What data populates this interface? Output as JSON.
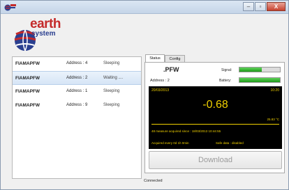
{
  "window": {
    "controls": {
      "minimize": "–",
      "maximize": "▫",
      "close": "X"
    }
  },
  "logo": {
    "earth": "earth",
    "system": "system"
  },
  "devices": [
    {
      "name": "FIAMAPFW",
      "address": "Address : 4",
      "status": "Sleeping",
      "selected": false
    },
    {
      "name": "FIAMAPFW",
      "address": "Address : 2",
      "status": "Waiting ....",
      "selected": true
    },
    {
      "name": "FIAMAPFW",
      "address": "Address : 1",
      "status": "Sleeping",
      "selected": false
    },
    {
      "name": "FIAMAPFW",
      "address": "Address : 9",
      "status": "Sleeping",
      "selected": false
    }
  ],
  "tabs": [
    {
      "label": "Status",
      "active": true
    },
    {
      "label": "Config",
      "active": false
    }
  ],
  "status_panel": {
    "device_title": ".PFW",
    "address": "Address :  2",
    "signal_label": "Signal:",
    "battery_label": "Battery:",
    "signal_level": 0.55,
    "battery_level": 1.0,
    "measure": {
      "date": "20/03/2013",
      "time": "10:20",
      "value": "-0.68",
      "temperature": "25.83 °C",
      "acquired_since": "48 measure acquired since : 18/03/2013 10:44:55",
      "acquired_every": "Acquired every 0d 1h 0min",
      "safe_data": "Safe data : disabled"
    },
    "download_label": "Download"
  },
  "statusbar": {
    "text": "Connected"
  },
  "colors": {
    "measure_fg": "#f0d000",
    "measure_bg": "#000000",
    "bar_fill": "#1e9a18",
    "logo_red": "#c42a2a",
    "logo_blue": "#2a3f8f"
  }
}
